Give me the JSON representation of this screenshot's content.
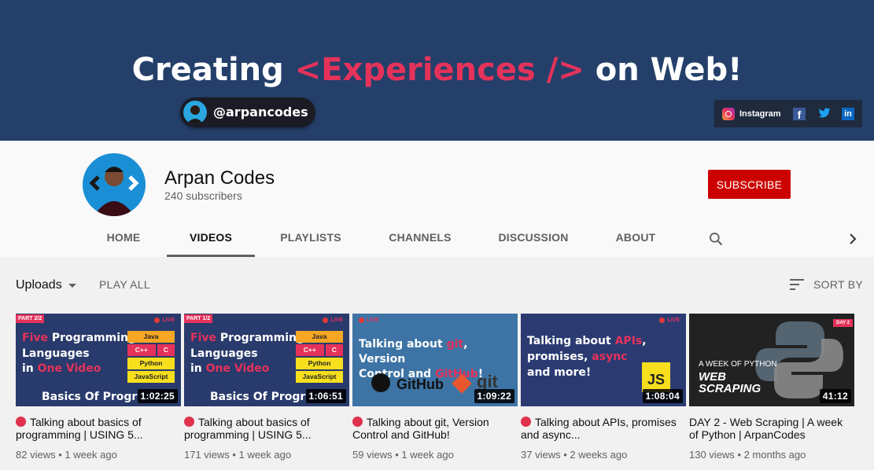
{
  "banner": {
    "headline_part1": "Creating ",
    "headline_accent": "<Experiences />",
    "headline_part2": " on Web!",
    "handle": "@arpancodes",
    "social": {
      "instagram": "Instagram"
    }
  },
  "channel": {
    "name": "Arpan Codes",
    "subscribers": "240 subscribers",
    "subscribe_label": "SUBSCRIBE"
  },
  "tabs": [
    {
      "label": "HOME"
    },
    {
      "label": "VIDEOS"
    },
    {
      "label": "PLAYLISTS"
    },
    {
      "label": "CHANNELS"
    },
    {
      "label": "DISCUSSION"
    },
    {
      "label": "ABOUT"
    }
  ],
  "controls": {
    "uploads_label": "Uploads",
    "play_all_label": "PLAY ALL",
    "sort_label": "SORT BY"
  },
  "videos": [
    {
      "title": "Talking about basics of programming | USING 5...",
      "meta": "82 views • 1 week ago",
      "duration": "1:02:25",
      "live": true,
      "thumb": {
        "tag": "PART 2/2",
        "live": "LIVE",
        "line1a": "Five",
        "line1b": " Programming",
        "line2": "Languages",
        "line3a": "in ",
        "line3b": "One Video",
        "langs": [
          "Java",
          "C++",
          "C",
          "Python",
          "JavaScript"
        ],
        "sub": "Basics Of Progr"
      }
    },
    {
      "title": "Talking about basics of programming | USING 5...",
      "meta": "171 views • 1 week ago",
      "duration": "1:06:51",
      "live": true,
      "thumb": {
        "tag": "PART 1/2",
        "live": "LIVE",
        "line1a": "Five",
        "line1b": " Programming",
        "line2": "Languages",
        "line3a": "in ",
        "line3b": "One Video",
        "langs": [
          "Java",
          "C++",
          "C",
          "Python",
          "JavaScript"
        ],
        "sub": "Basics Of Progr"
      }
    },
    {
      "title": "Talking about git, Version Control and GitHub!",
      "meta": "59 views • 1 week ago",
      "duration": "1:09:22",
      "live": true,
      "thumb": {
        "live": "LIVE",
        "l1a": "Talking about ",
        "l1b": "git",
        "l1c": ", Version",
        "l2a": "Control and ",
        "l2b": "GitHub",
        "l2c": "!",
        "github": "GitHub",
        "git": "git"
      }
    },
    {
      "title": "Talking about APIs, promises and async...",
      "meta": "37 views • 2 weeks ago",
      "duration": "1:08:04",
      "live": true,
      "thumb": {
        "live": "LIVE",
        "l1a": "Talking about ",
        "l1b": "APIs",
        "l1c": ",",
        "l2a": "promises, ",
        "l2b": "async",
        "l3": "and more!",
        "js": "JS"
      }
    },
    {
      "title": "DAY 2 - Web Scraping | A week of Python | ArpanCodes",
      "meta": "130 views • 2 months ago",
      "duration": "41:12",
      "live": false,
      "thumb": {
        "day": "DAY 2",
        "small": "A WEEK OF PYTHON",
        "big1": "WEB",
        "big2": "SCRAPING"
      }
    }
  ],
  "colors": {
    "banner_bg": "#24406a",
    "accent": "#e5325a",
    "subscribe": "#cc0000"
  }
}
